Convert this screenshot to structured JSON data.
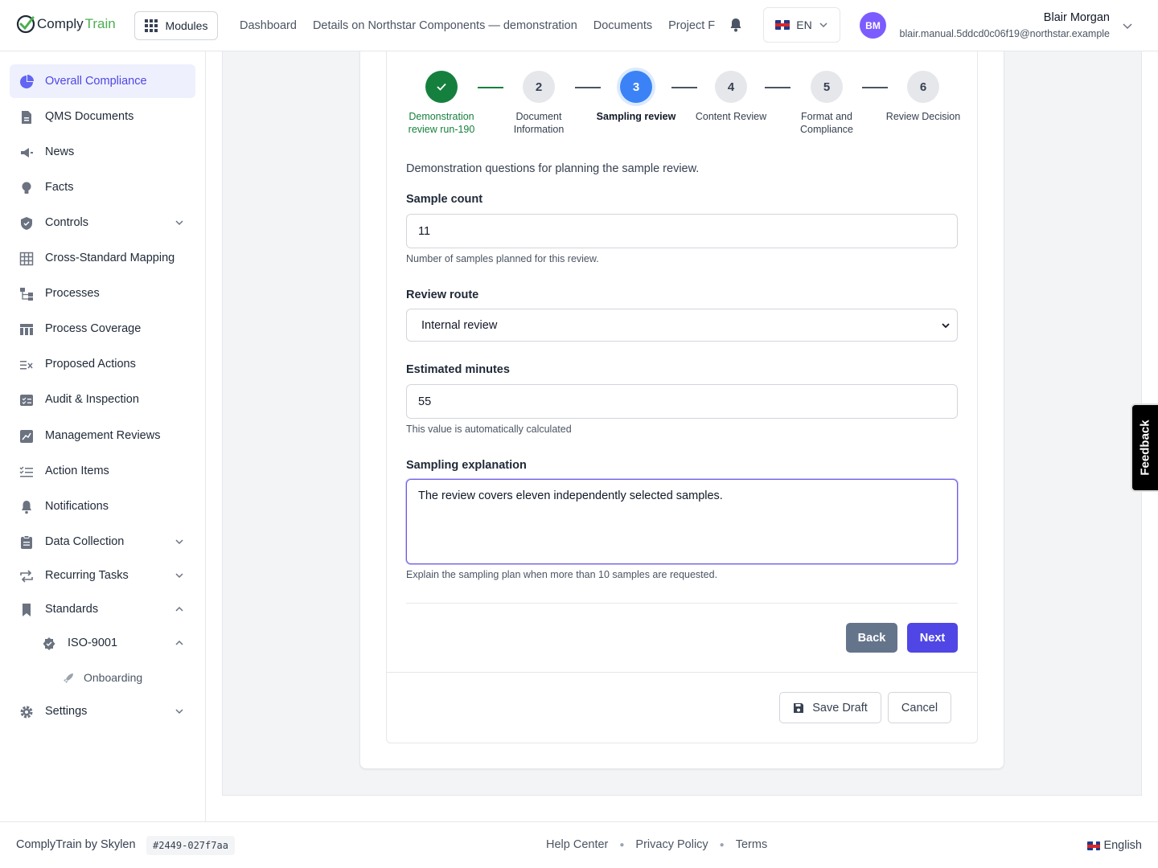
{
  "header": {
    "logo": {
      "part1": "Comply",
      "part2": "Train"
    },
    "modules_label": "Modules",
    "nav": [
      {
        "label": "Dashboard"
      },
      {
        "label": "Details on Northstar Components — demonstration"
      },
      {
        "label": "Documents"
      },
      {
        "label": "Project F"
      }
    ],
    "language": "EN",
    "user": {
      "initials": "BM",
      "name": "Blair Morgan",
      "email": "blair.manual.5ddcd0c06f19@northstar.example"
    }
  },
  "sidebar": {
    "items": [
      {
        "label": "Overall Compliance",
        "icon": "pie-chart-icon"
      },
      {
        "label": "QMS Documents",
        "icon": "document-icon"
      },
      {
        "label": "News",
        "icon": "megaphone-icon"
      },
      {
        "label": "Facts",
        "icon": "lightbulb-icon"
      },
      {
        "label": "Controls",
        "icon": "shield-icon"
      },
      {
        "label": "Cross-Standard Mapping",
        "icon": "table-icon"
      },
      {
        "label": "Processes",
        "icon": "flow-icon"
      },
      {
        "label": "Process Coverage",
        "icon": "columns-icon"
      },
      {
        "label": "Proposed Actions",
        "icon": "proposed-list-icon"
      },
      {
        "label": "Audit & Inspection",
        "icon": "checklist-icon"
      },
      {
        "label": "Management Reviews",
        "icon": "chart-board-icon"
      },
      {
        "label": "Action Items",
        "icon": "tasks-icon"
      },
      {
        "label": "Notifications",
        "icon": "bell-icon"
      },
      {
        "label": "Data Collection",
        "icon": "clipboard-icon"
      },
      {
        "label": "Recurring Tasks",
        "icon": "repeat-icon"
      },
      {
        "label": "Standards",
        "icon": "bookmark-icon"
      },
      {
        "label": "ISO-9001",
        "icon": "badge-check-icon"
      },
      {
        "label": "Onboarding",
        "icon": "rocket-icon"
      },
      {
        "label": "Settings",
        "icon": "gear-icon"
      }
    ]
  },
  "stepper": {
    "steps": [
      {
        "number": "✓",
        "label": "Demonstration review run-190",
        "state": "done"
      },
      {
        "number": "2",
        "label": "Document Information",
        "state": "pending"
      },
      {
        "number": "3",
        "label": "Sampling review",
        "state": "current"
      },
      {
        "number": "4",
        "label": "Content Review",
        "state": "pending"
      },
      {
        "number": "5",
        "label": "Format and Compliance",
        "state": "pending"
      },
      {
        "number": "6",
        "label": "Review Decision",
        "state": "pending"
      }
    ]
  },
  "form": {
    "intro": "Demonstration questions for planning the sample review.",
    "sample_count": {
      "label": "Sample count",
      "value": "11",
      "help": "Number of samples planned for this review."
    },
    "review_route": {
      "label": "Review route",
      "value": "Internal review"
    },
    "estimated_minutes": {
      "label": "Estimated minutes",
      "value": "55",
      "help": "This value is automatically calculated"
    },
    "sampling_explanation": {
      "label": "Sampling explanation",
      "value": "The review covers eleven independently selected samples.",
      "help": "Explain the sampling plan when more than 10 samples are requested."
    },
    "back_label": "Back",
    "next_label": "Next",
    "save_draft_label": "Save Draft",
    "cancel_label": "Cancel"
  },
  "feedback_label": "Feedback",
  "footer": {
    "brand": "ComplyTrain by Skylen",
    "build": "#2449-027f7aa",
    "links": [
      "Help Center",
      "Privacy Policy",
      "Terms"
    ],
    "language": "English"
  },
  "colors": {
    "accent": "#4f46e5",
    "done": "#15803d",
    "current_step": "#3b82f6",
    "logo_green": "#4caf50"
  }
}
